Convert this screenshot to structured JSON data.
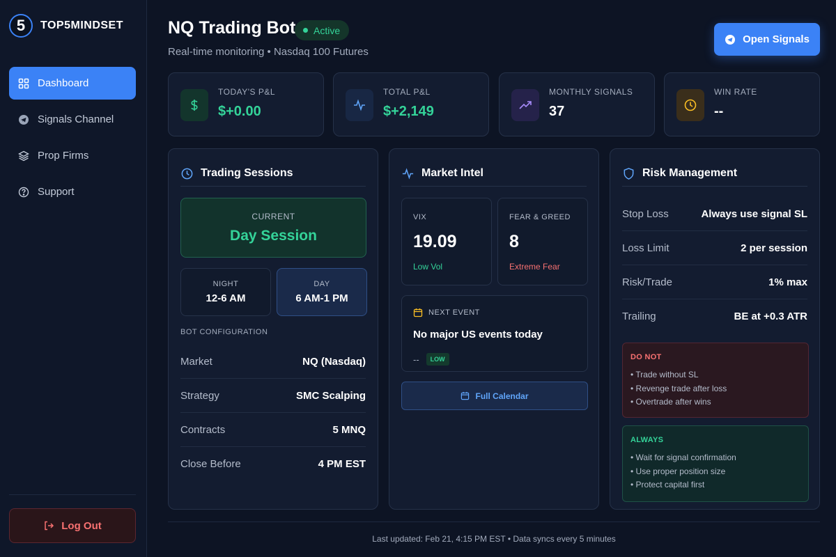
{
  "brand": {
    "logo_glyph": "5",
    "name": "TOP5MINDSET"
  },
  "sidebar": {
    "items": [
      {
        "label": "Dashboard",
        "icon": "grid-icon",
        "active": true
      },
      {
        "label": "Signals Channel",
        "icon": "telegram-icon",
        "active": false
      },
      {
        "label": "Prop Firms",
        "icon": "layers-icon",
        "active": false
      },
      {
        "label": "Support",
        "icon": "help-circle-icon",
        "active": false
      }
    ],
    "logout_label": "Log Out"
  },
  "header": {
    "title": "NQ Trading Bot",
    "status": "Active",
    "subtitle": "Real-time monitoring • Nasdaq 100 Futures",
    "open_signals_label": "Open Signals"
  },
  "stats": [
    {
      "label": "TODAY'S P&L",
      "value": "$+0.00",
      "icon": "dollar-icon",
      "value_color": "#34d399"
    },
    {
      "label": "TOTAL P&L",
      "value": "$+2,149",
      "icon": "activity-icon",
      "value_color": "#34d399"
    },
    {
      "label": "MONTHLY SIGNALS",
      "value": "37",
      "icon": "trending-up-icon",
      "value_color": "#ffffff"
    },
    {
      "label": "WIN RATE",
      "value": "--",
      "icon": "clock-icon",
      "value_color": "#ffffff"
    }
  ],
  "trading_sessions": {
    "title": "Trading Sessions",
    "current_label": "CURRENT",
    "current_value": "Day Session",
    "sessions": [
      {
        "label": "NIGHT",
        "time": "12-6 AM",
        "active": false
      },
      {
        "label": "DAY",
        "time": "6 AM-1 PM",
        "active": true
      }
    ],
    "config_caption": "BOT CONFIGURATION",
    "config": [
      {
        "key": "Market",
        "value": "NQ (Nasdaq)"
      },
      {
        "key": "Strategy",
        "value": "SMC Scalping"
      },
      {
        "key": "Contracts",
        "value": "5 MNQ"
      },
      {
        "key": "Close Before",
        "value": "4 PM EST"
      }
    ]
  },
  "market_intel": {
    "title": "Market Intel",
    "vix": {
      "label": "VIX",
      "value": "19.09",
      "note": "Low Vol",
      "note_color": "#34d399"
    },
    "fear_greed": {
      "label": "FEAR & GREED",
      "value": "8",
      "note": "Extreme Fear",
      "note_color": "#f87171"
    },
    "next_event": {
      "caption": "NEXT EVENT",
      "title": "No major US events today",
      "time": "--",
      "impact": "LOW"
    },
    "calendar_label": "Full Calendar"
  },
  "risk_management": {
    "title": "Risk Management",
    "rows": [
      {
        "key": "Stop Loss",
        "value": "Always use signal SL"
      },
      {
        "key": "Loss Limit",
        "value": "2 per session"
      },
      {
        "key": "Risk/Trade",
        "value": "1% max"
      },
      {
        "key": "Trailing",
        "value": "BE at +0.3 ATR"
      }
    ],
    "dont": {
      "title": "DO NOT",
      "items": [
        "• Trade without SL",
        "• Revenge trade after loss",
        "• Overtrade after wins"
      ]
    },
    "always": {
      "title": "ALWAYS",
      "items": [
        "• Wait for signal confirmation",
        "• Use proper position size",
        "• Protect capital first"
      ]
    }
  },
  "footer": {
    "text": "Last updated: Feb 21, 4:15 PM EST • Data syncs every 5 minutes"
  }
}
